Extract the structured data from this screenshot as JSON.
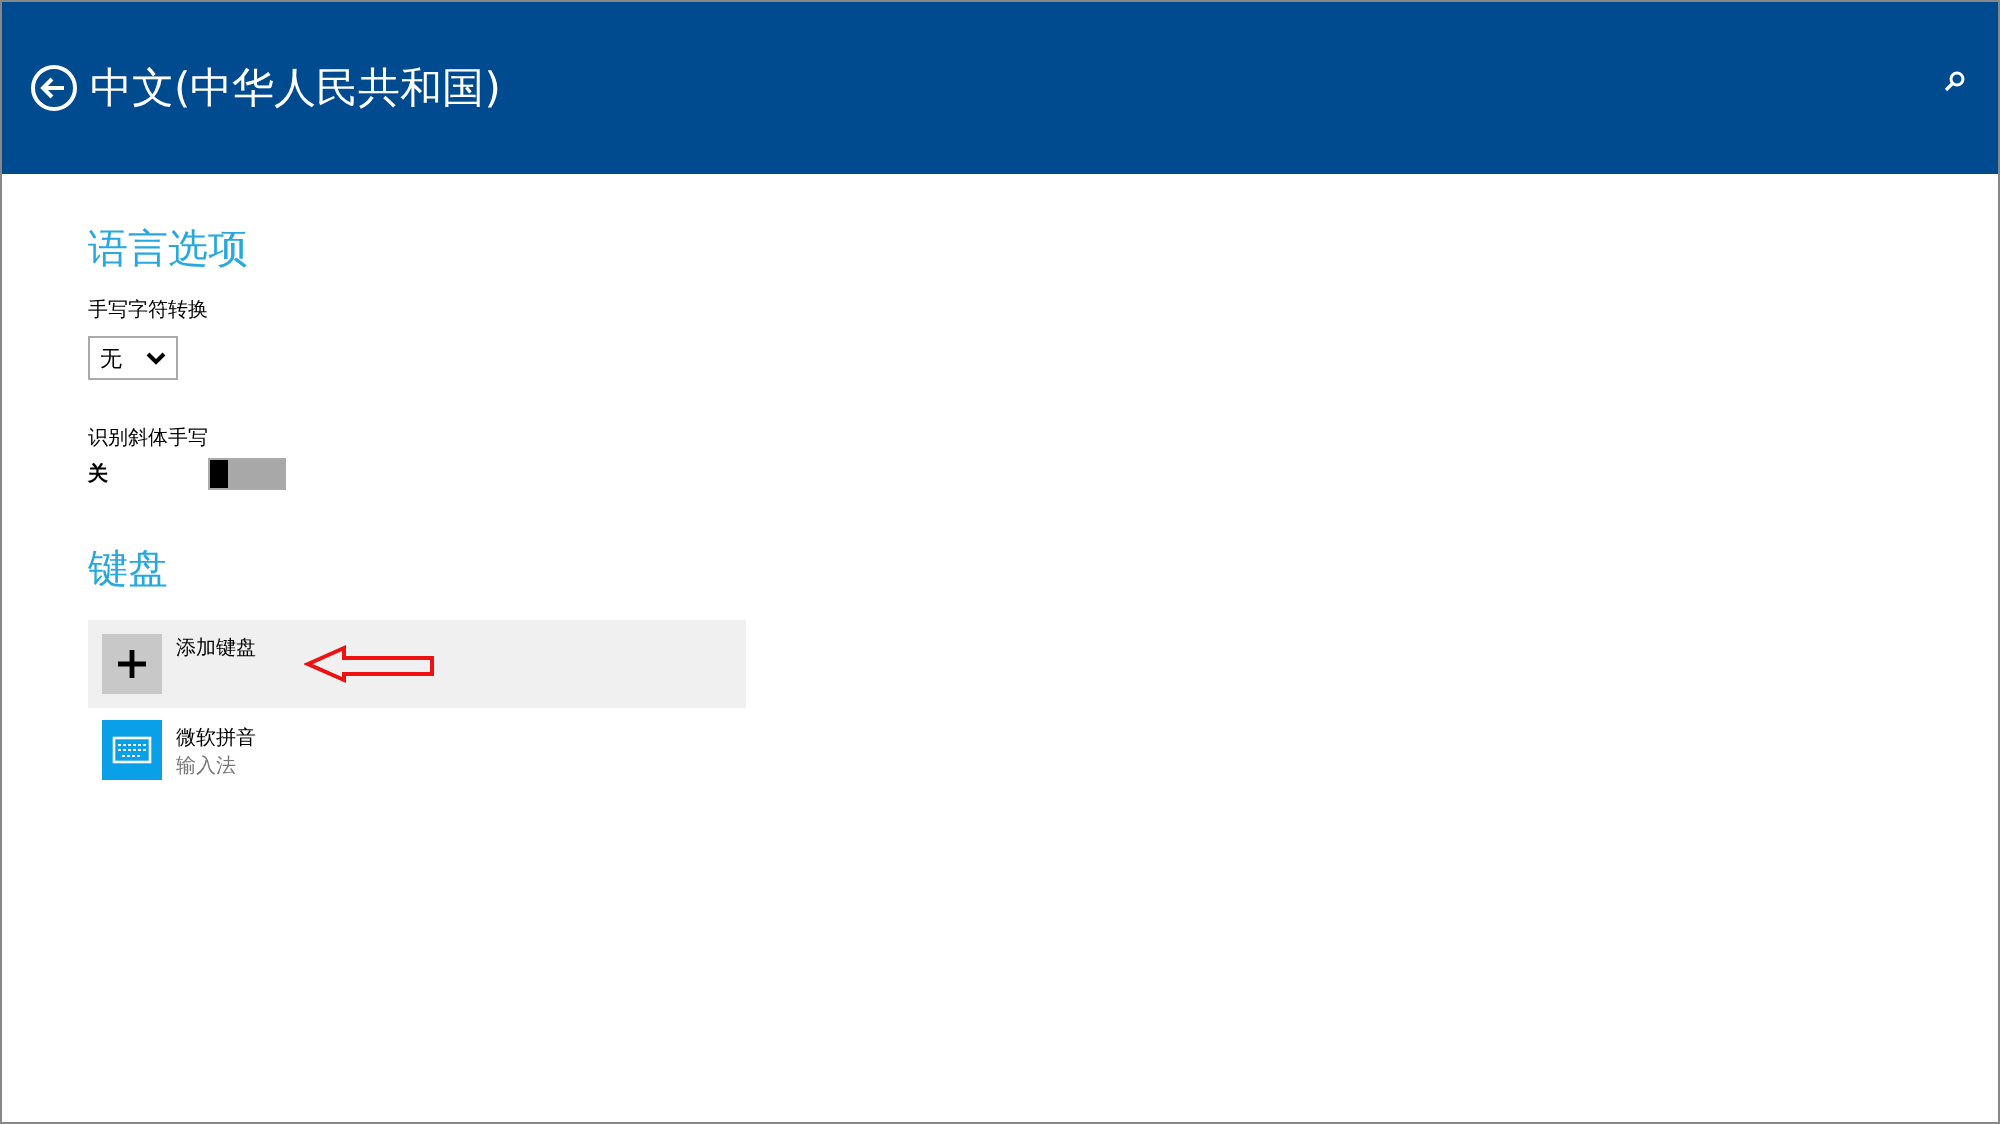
{
  "header": {
    "title": "中文(中华人民共和国)"
  },
  "language_options": {
    "heading": "语言选项",
    "handwriting_conversion": {
      "label": "手写字符转换",
      "value": "无"
    },
    "cursive_recognition": {
      "label": "识别斜体手写",
      "state_text": "关",
      "on": false
    }
  },
  "keyboards": {
    "heading": "键盘",
    "items": [
      {
        "kind": "add",
        "title": "添加键盘",
        "selected": true
      },
      {
        "kind": "keyboard",
        "title": "微软拼音",
        "subtitle": "输入法",
        "selected": false
      }
    ]
  }
}
